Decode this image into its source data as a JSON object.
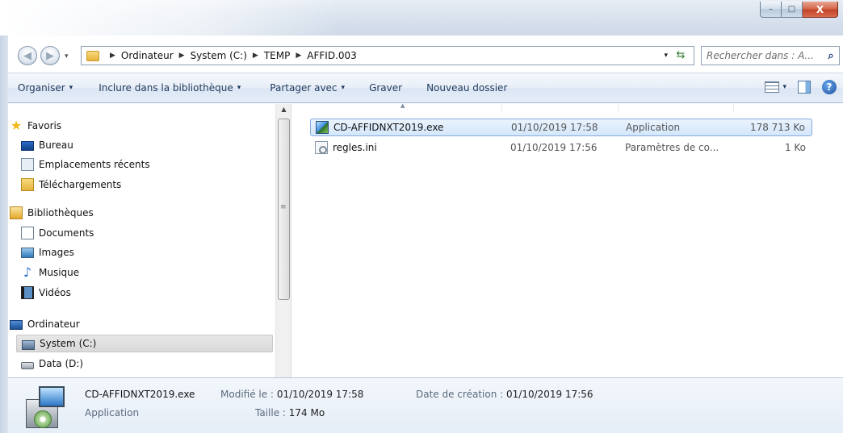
{
  "window": {
    "caption_buttons": {
      "minimize": "–",
      "maximize": "□",
      "close": "X"
    }
  },
  "address_bar": {
    "breadcrumbs": [
      "Ordinateur",
      "System (C:)",
      "TEMP",
      "AFFID.003"
    ],
    "separator": "▶",
    "dropdown_glyph": "▾",
    "refresh_glyph": "⇆"
  },
  "search": {
    "placeholder": "Rechercher dans : A...",
    "icon": "⌕"
  },
  "toolbar": {
    "organise": "Organiser",
    "include": "Inclure dans la bibliothèque",
    "share": "Partager avec",
    "burn": "Graver",
    "new_folder": "Nouveau dossier",
    "dropdown_glyph": "▾",
    "help": "?"
  },
  "nav": {
    "favorites": {
      "label": "Favoris",
      "items": [
        "Bureau",
        "Emplacements récents",
        "Téléchargements"
      ]
    },
    "libraries": {
      "label": "Bibliothèques",
      "items": [
        "Documents",
        "Images",
        "Musique",
        "Vidéos"
      ]
    },
    "computer": {
      "label": "Ordinateur",
      "items": [
        "System (C:)",
        "Data (D:)"
      ],
      "selected": "System (C:)"
    },
    "scroll_up": "▲",
    "grip": "≡"
  },
  "files": [
    {
      "name": "CD-AFFIDNXT2019.exe",
      "date": "01/10/2019 17:58",
      "type": "Application",
      "size": "178 713 Ko",
      "icon": "setup-exe-icon",
      "selected": true
    },
    {
      "name": "regles.ini",
      "date": "01/10/2019 17:56",
      "type": "Paramètres de co...",
      "size": "1 Ko",
      "icon": "ini-settings-icon",
      "selected": false
    }
  ],
  "details": {
    "name": "CD-AFFIDNXT2019.exe",
    "type": "Application",
    "modified_label": "Modifié le :",
    "modified_value": "01/10/2019 17:58",
    "size_label": "Taille :",
    "size_value": "174 Mo",
    "created_label": "Date de création :",
    "created_value": "01/10/2019 17:56"
  },
  "colors": {
    "selection_fill": "#d4e7fb",
    "selection_border": "#84acdd",
    "command_text": "#1e395b"
  }
}
